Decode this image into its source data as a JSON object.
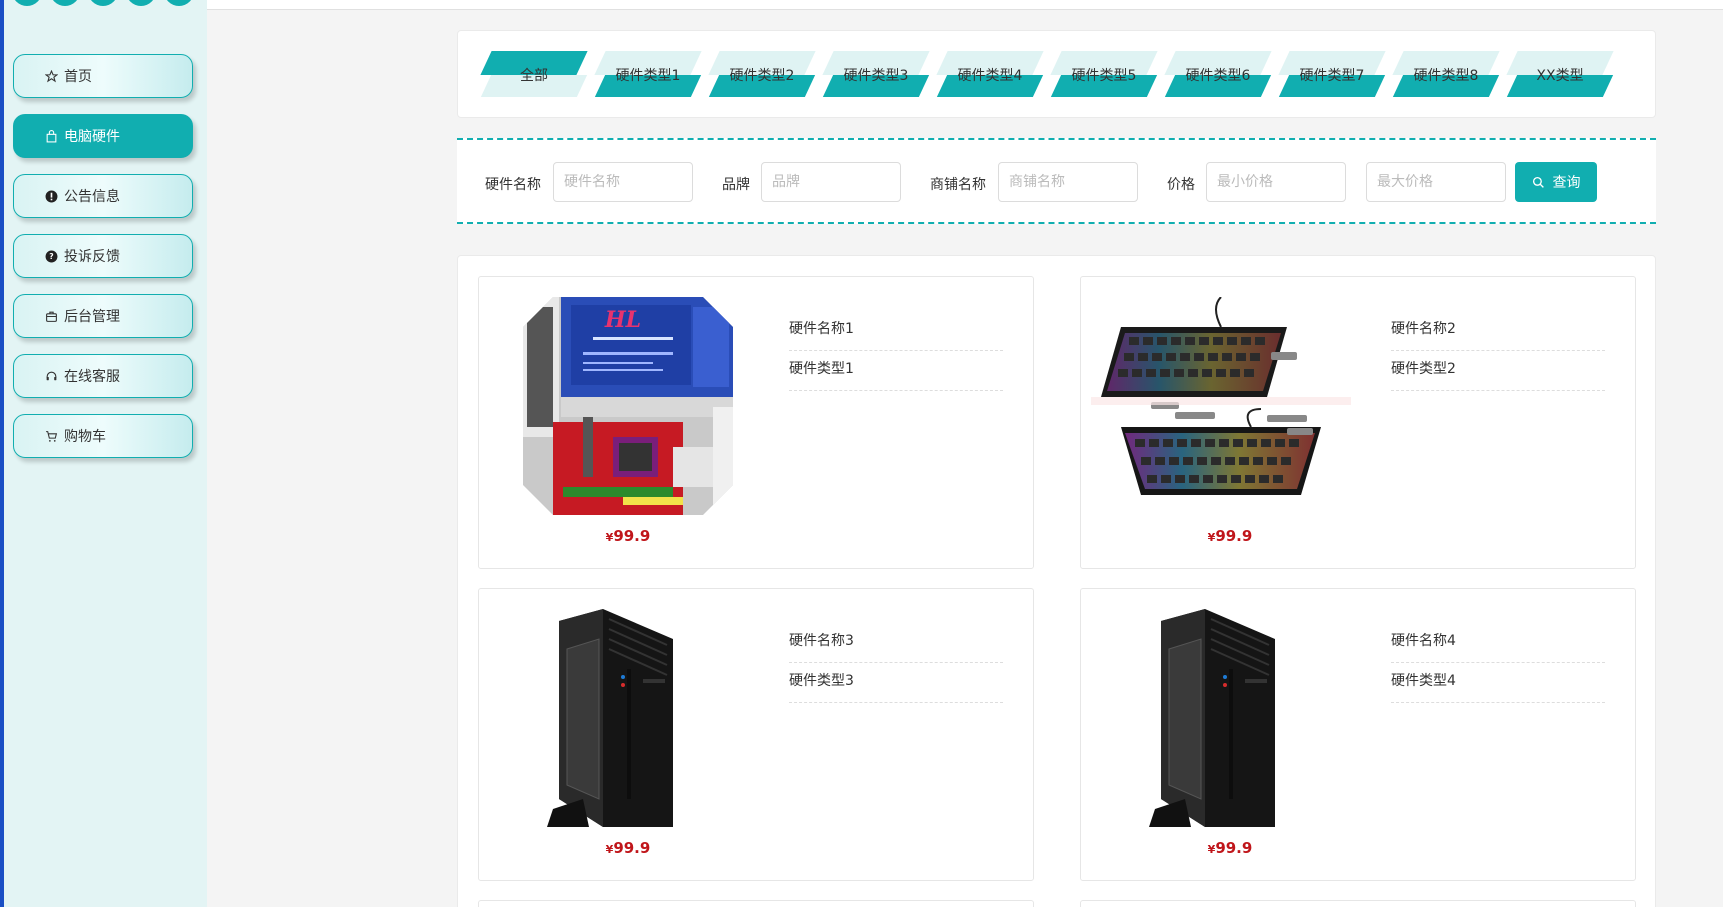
{
  "sidebar": {
    "items": [
      {
        "label": "首页",
        "icon": "star-icon",
        "active": false
      },
      {
        "label": "电脑硬件",
        "icon": "bag-icon",
        "active": true
      },
      {
        "label": "公告信息",
        "icon": "alert-icon",
        "active": false
      },
      {
        "label": "投诉反馈",
        "icon": "question-icon",
        "active": false
      },
      {
        "label": "后台管理",
        "icon": "briefcase-icon",
        "active": false
      },
      {
        "label": "在线客服",
        "icon": "headset-icon",
        "active": false
      },
      {
        "label": "购物车",
        "icon": "cart-icon",
        "active": false
      }
    ]
  },
  "categories": [
    "全部",
    "硬件类型1",
    "硬件类型2",
    "硬件类型3",
    "硬件类型4",
    "硬件类型5",
    "硬件类型6",
    "硬件类型7",
    "硬件类型8",
    "XX类型"
  ],
  "search": {
    "name_label": "硬件名称",
    "name_placeholder": "硬件名称",
    "brand_label": "品牌",
    "brand_placeholder": "品牌",
    "shop_label": "商铺名称",
    "shop_placeholder": "商铺名称",
    "price_label": "价格",
    "min_placeholder": "最小价格",
    "max_placeholder": "最大价格",
    "button_label": "查询"
  },
  "products": [
    {
      "name": "硬件名称1",
      "type": "硬件类型1",
      "currency": "¥",
      "price": "99.9",
      "image": "motherboard"
    },
    {
      "name": "硬件名称2",
      "type": "硬件类型2",
      "currency": "¥",
      "price": "99.9",
      "image": "keyboard"
    },
    {
      "name": "硬件名称3",
      "type": "硬件类型3",
      "currency": "¥",
      "price": "99.9",
      "image": "pc-case"
    },
    {
      "name": "硬件名称4",
      "type": "硬件类型4",
      "currency": "¥",
      "price": "99.9",
      "image": "pc-case"
    }
  ],
  "colors": {
    "accent": "#11aeb0",
    "price": "#c0161b",
    "edge": "#1a4fc4"
  }
}
